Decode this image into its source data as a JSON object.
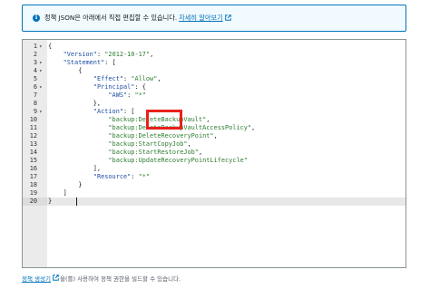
{
  "info": {
    "text": "정책 JSON은 아래에서 직접 편집할 수 있습니다.",
    "link": "자세히 알아보기"
  },
  "editor": {
    "lines": [
      {
        "n": "1",
        "fold": "▾",
        "text": "{"
      },
      {
        "n": "2",
        "fold": "",
        "text": "    \"Version\": \"2012-10-17\","
      },
      {
        "n": "3",
        "fold": "▾",
        "text": "    \"Statement\": ["
      },
      {
        "n": "4",
        "fold": "▾",
        "text": "        {"
      },
      {
        "n": "5",
        "fold": "",
        "text": "            \"Effect\": \"Allow\","
      },
      {
        "n": "6",
        "fold": "▾",
        "text": "            \"Principal\": {"
      },
      {
        "n": "7",
        "fold": "",
        "text": "                \"AWS\": \"*\""
      },
      {
        "n": "8",
        "fold": "",
        "text": "            },"
      },
      {
        "n": "9",
        "fold": "▾",
        "text": "            \"Action\": ["
      },
      {
        "n": "10",
        "fold": "",
        "text": "                \"backup:DeleteBackupVault\","
      },
      {
        "n": "11",
        "fold": "",
        "text": "                \"backup:DeleteBackupVaultAccessPolicy\","
      },
      {
        "n": "12",
        "fold": "",
        "text": "                \"backup:DeleteRecoveryPoint\","
      },
      {
        "n": "13",
        "fold": "",
        "text": "                \"backup:StartCopyJob\","
      },
      {
        "n": "14",
        "fold": "",
        "text": "                \"backup:StartRestoreJob\","
      },
      {
        "n": "15",
        "fold": "",
        "text": "                \"backup:UpdateRecoveryPointLifecycle\""
      },
      {
        "n": "16",
        "fold": "",
        "text": "            ],"
      },
      {
        "n": "17",
        "fold": "",
        "text": "            \"Resource\": \"*\""
      },
      {
        "n": "18",
        "fold": "",
        "text": "        }"
      },
      {
        "n": "19",
        "fold": "",
        "text": "    ]"
      },
      {
        "n": "20",
        "fold": "",
        "text": "}"
      }
    ]
  },
  "footer": {
    "link": "정책 생성기",
    "text": "을(를) 사용하여 정책 권한을 빌드할 수 있습니다."
  },
  "colors": {
    "accent": "#0073bb",
    "highlight": "#e8211b"
  }
}
